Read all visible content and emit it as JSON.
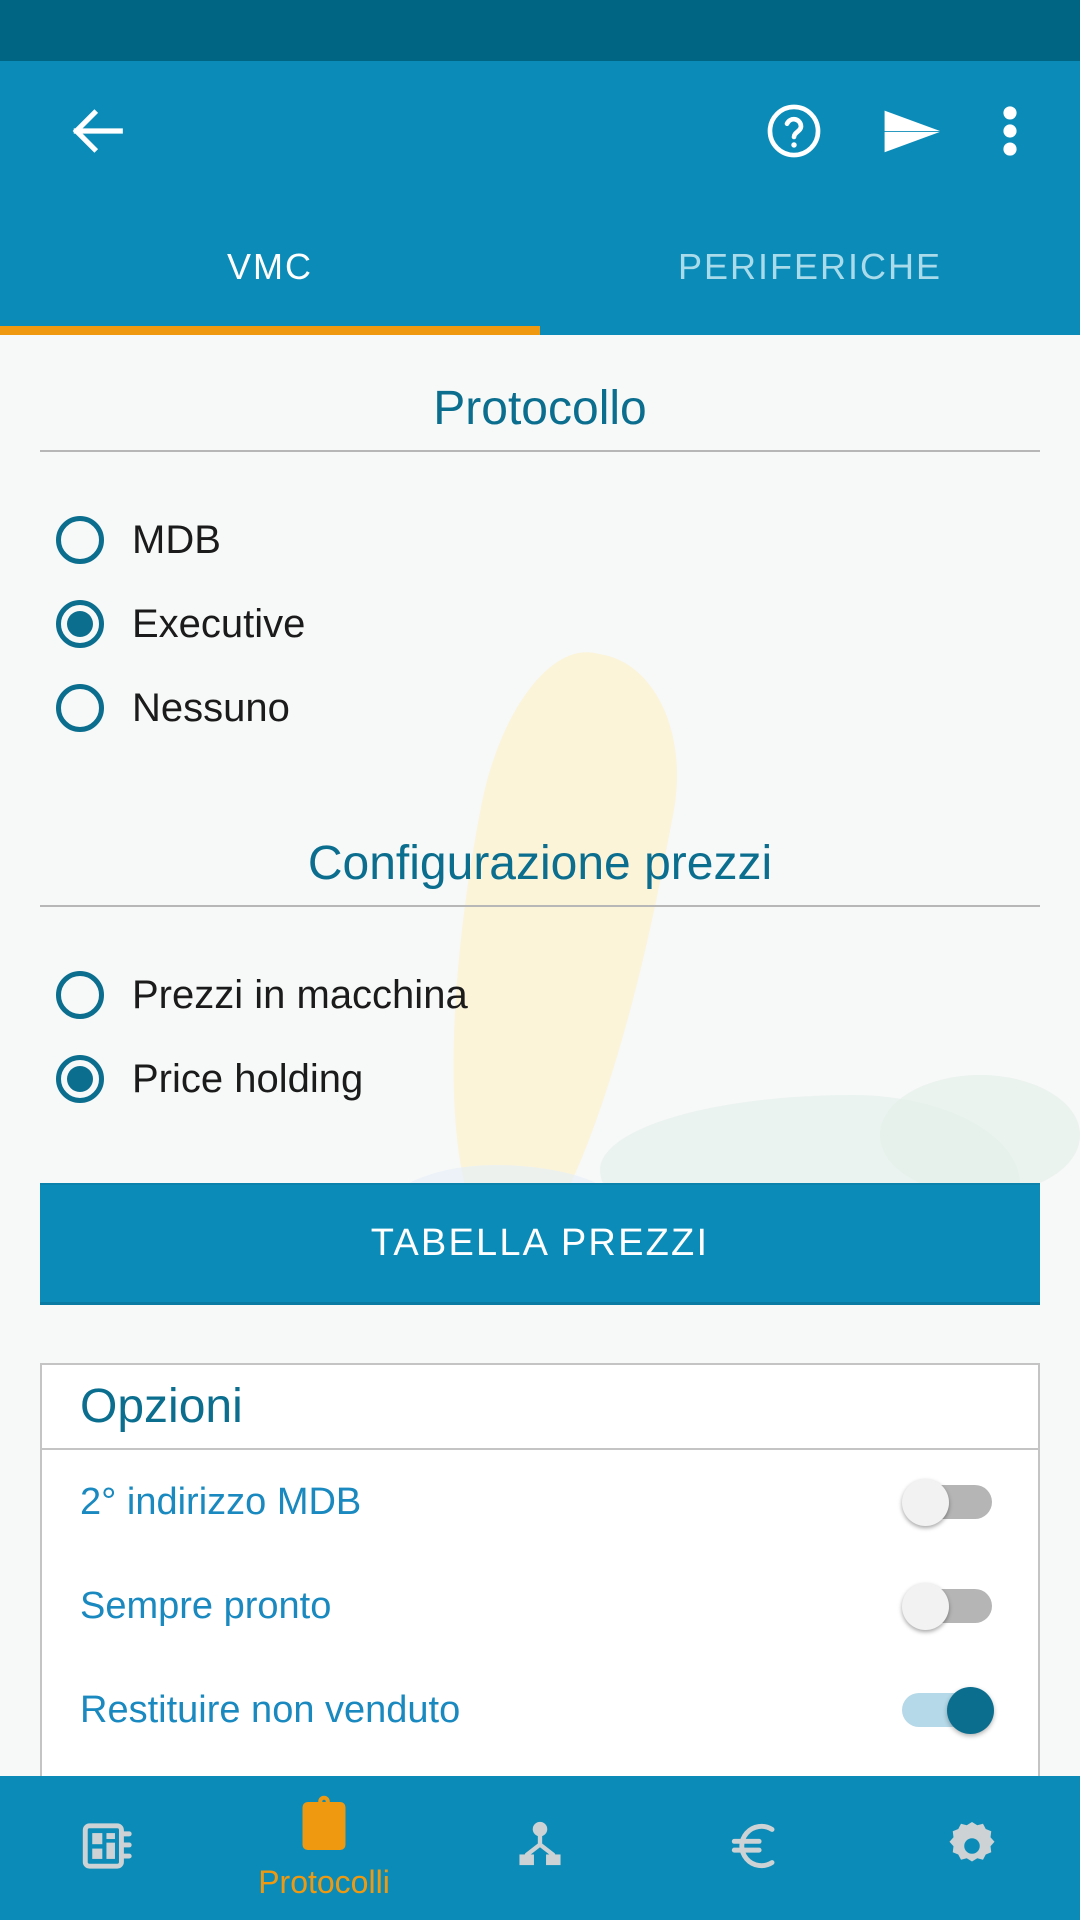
{
  "app_bar": {
    "back_icon": "arrow-left-icon",
    "help_icon": "help-circle-icon",
    "send_icon": "send-icon",
    "more_icon": "overflow-menu-icon"
  },
  "tabs": [
    {
      "label": "VMC",
      "active": true
    },
    {
      "label": "PERIFERICHE",
      "active": false
    }
  ],
  "sections": [
    {
      "title": "Protocollo",
      "options": [
        {
          "label": "MDB",
          "checked": false
        },
        {
          "label": "Executive",
          "checked": true
        },
        {
          "label": "Nessuno",
          "checked": false
        }
      ]
    },
    {
      "title": "Configurazione prezzi",
      "options": [
        {
          "label": "Prezzi in macchina",
          "checked": false
        },
        {
          "label": "Price holding",
          "checked": true
        }
      ]
    }
  ],
  "price_table_button": {
    "label": "TABELLA PREZZI"
  },
  "options_card": {
    "title": "Opzioni",
    "rows": [
      {
        "label": "2° indirizzo MDB",
        "on": false
      },
      {
        "label": "Sempre pronto",
        "on": false
      },
      {
        "label": "Restituire non venduto",
        "on": true
      }
    ]
  },
  "bottom_nav": [
    {
      "icon": "vending-machine-icon",
      "label": "",
      "active": false
    },
    {
      "icon": "clipboard-icon",
      "label": "Protocolli",
      "active": true
    },
    {
      "icon": "sitemap-icon",
      "label": "",
      "active": false
    },
    {
      "icon": "euro-icon",
      "label": "",
      "active": false
    },
    {
      "icon": "gear-icon",
      "label": "",
      "active": false
    }
  ],
  "colors": {
    "status_bar": "#006582",
    "app_bar": "#0b8cb8",
    "accent_orange": "#ef9911",
    "heading_teal": "#0b6e8f",
    "option_label_blue": "#1a89bf",
    "page_bg": "#f7f8f8"
  }
}
